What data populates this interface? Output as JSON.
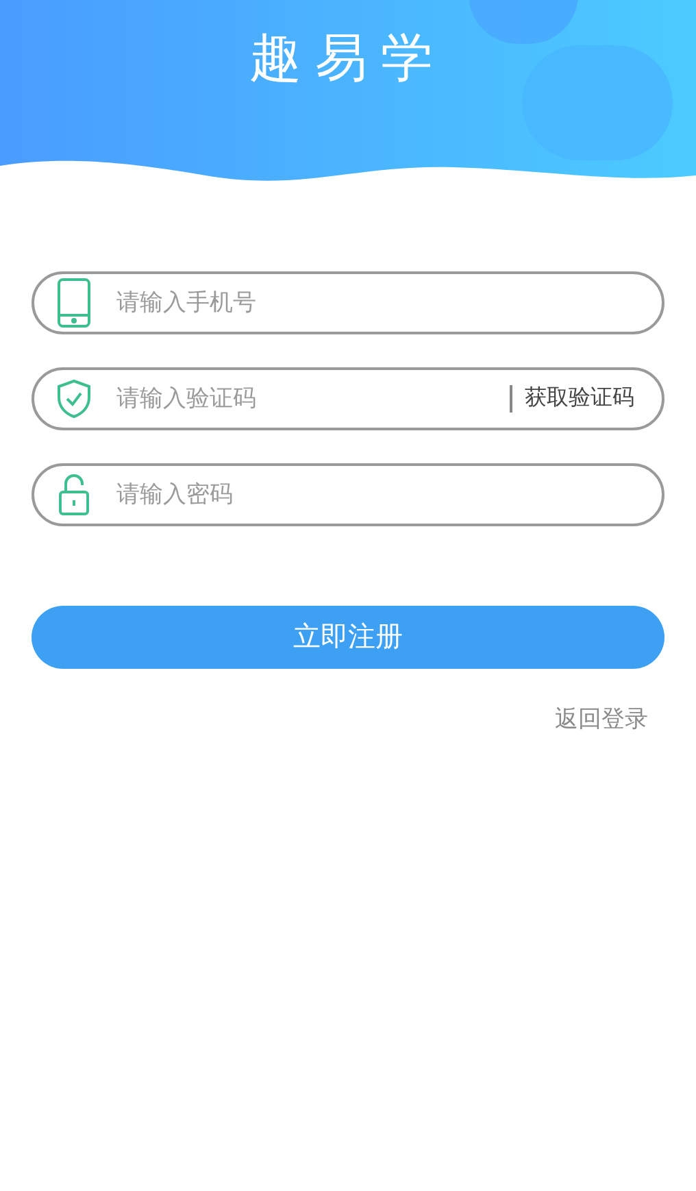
{
  "header": {
    "title": "趣易学"
  },
  "fields": [
    {
      "kind": "phone",
      "placeholder": "请输入手机号"
    },
    {
      "kind": "code",
      "placeholder": "请输入验证码",
      "action": "获取验证码"
    },
    {
      "kind": "password",
      "placeholder": "请输入密码"
    }
  ],
  "submit": "立即注册",
  "back_link": "返回登录"
}
